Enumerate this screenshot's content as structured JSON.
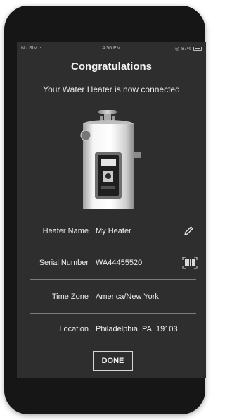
{
  "status_bar": {
    "carrier": "No SIM",
    "time": "4:56 PM",
    "battery": "87%"
  },
  "screen": {
    "title": "Congratulations",
    "subtitle": "Your Water Heater is now connected"
  },
  "details": [
    {
      "label": "Heater Name",
      "value": "My Heater",
      "icon": "pencil-icon"
    },
    {
      "label": "Serial Number",
      "value": "WA44455520",
      "icon": "barcode-icon"
    },
    {
      "label": "Time Zone",
      "value": "America/New York"
    },
    {
      "label": "Location",
      "value": "Philadelphia, PA, 19103"
    }
  ],
  "actions": {
    "done_label": "DONE"
  }
}
